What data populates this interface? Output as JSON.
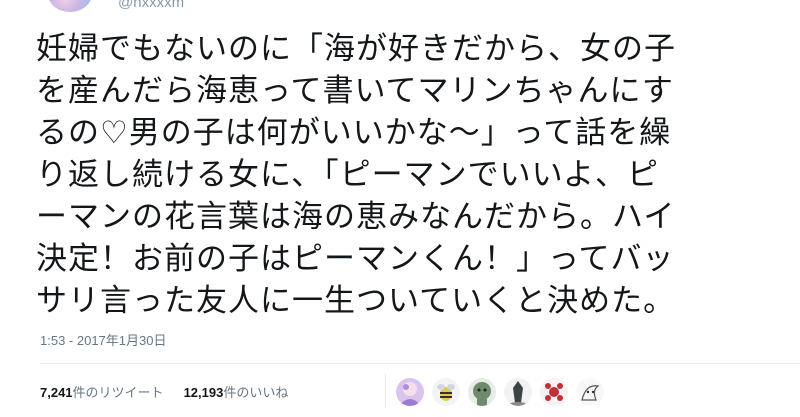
{
  "user": {
    "handle": "@hxxxxm"
  },
  "tweet": {
    "lines": [
      "妊婦でもないのに「海が好きだから、女の子",
      "を産んだら海恵って書いてマリンちゃんにす",
      "るの♡男の子は何がいいかな～」って話を繰",
      "り返し続ける女に、「ピーマンでいいよ、ピ",
      "ーマンの花言葉は海の恵みなんだから。ハイ",
      "決定！お前の子はピーマンくん！」ってバッ",
      "サリ言った友人に一生ついていくと決めた。"
    ],
    "timestamp": "1:53 - 2017年1月30日"
  },
  "stats": {
    "retweet_count": "7,241",
    "retweet_label": "件のリツイート",
    "like_count": "12,193",
    "like_label": "件のいいね"
  },
  "likers": [
    {
      "name": "liker-avatar-1",
      "color": "#c8a9e6"
    },
    {
      "name": "liker-avatar-2",
      "color": "#f1f1f1"
    },
    {
      "name": "liker-avatar-3",
      "color": "#6c7f6a"
    },
    {
      "name": "liker-avatar-4",
      "color": "#3f4a4a"
    },
    {
      "name": "liker-avatar-5",
      "color": "#e9e2e2"
    },
    {
      "name": "liker-avatar-6",
      "color": "#f3f3f3"
    }
  ]
}
